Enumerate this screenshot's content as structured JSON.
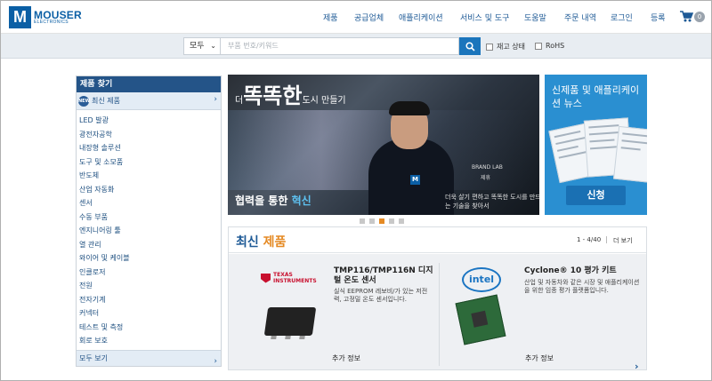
{
  "brand": {
    "name": "MOUSER",
    "sub": "ELECTRONICS",
    "mark": "M"
  },
  "nav": [
    "제품",
    "공급업체",
    "애플리케이션",
    "서비스 및 도구",
    "도움말",
    "주문 내역",
    "로그인",
    "등록"
  ],
  "cart": {
    "count": "0"
  },
  "search": {
    "category": "모두",
    "placeholder": "부품 번호/키워드",
    "in_stock_label": "재고 상태",
    "rohs_label": "RoHS"
  },
  "sidebar": {
    "title": "제품 찾기",
    "new_products": "최신 제품",
    "new_icon_text": "NEW",
    "items": [
      "LED 발광",
      "광전자공학",
      "내장형 솔루션",
      "도구 및 소모품",
      "반도체",
      "산업 자동화",
      "센서",
      "수동 부품",
      "엔지니어링 툴",
      "열 관리",
      "와이어 및 케이블",
      "인클로저",
      "전원",
      "전자기계",
      "커넥터",
      "테스트 및 측정",
      "회로 보호"
    ],
    "view_all": "모두 보기"
  },
  "banner": {
    "title_pre": "더",
    "title_bold": "똑똑한",
    "title_post": "도시 만들기",
    "caption_pre": "협력을 통한",
    "caption_highlight": "혁신",
    "description": "더욱 살기 편하고 똑똑한 도시를 만드는 기술을 찾아서",
    "brand_lab": "BRAND LAB",
    "badge_name": "제휴",
    "active_slide": 3,
    "slide_count": 5
  },
  "news": {
    "title": "신제품 및 애플리케이션 뉴스",
    "button": "신청"
  },
  "new_products": {
    "title_part1": "최신",
    "title_part2": "제품",
    "range": "1 - 4/40",
    "separator": "|",
    "view_more": "더 보기",
    "cards": [
      {
        "logo": "TEXAS INSTRUMENTS",
        "name": "TMP116/TMP116N 디지털 온도 센서",
        "desc": "실식 EEPROM 레보비/가 있는 저전력, 고정밀 온도 센서입니다.",
        "more": "추가 정보"
      },
      {
        "logo": "intel",
        "name": "Cyclone® 10 평가 키트",
        "desc": "산업 및 자동차와 같은 시장 및 애플리케이션을 위한 임종 평가 플랫폼입니다.",
        "more": "추가 정보"
      }
    ]
  },
  "colors": {
    "brand_blue": "#0b5fa5",
    "accent_orange": "#e58a24",
    "sidebar_header": "#245488",
    "news_blue": "#2a8fd1"
  }
}
